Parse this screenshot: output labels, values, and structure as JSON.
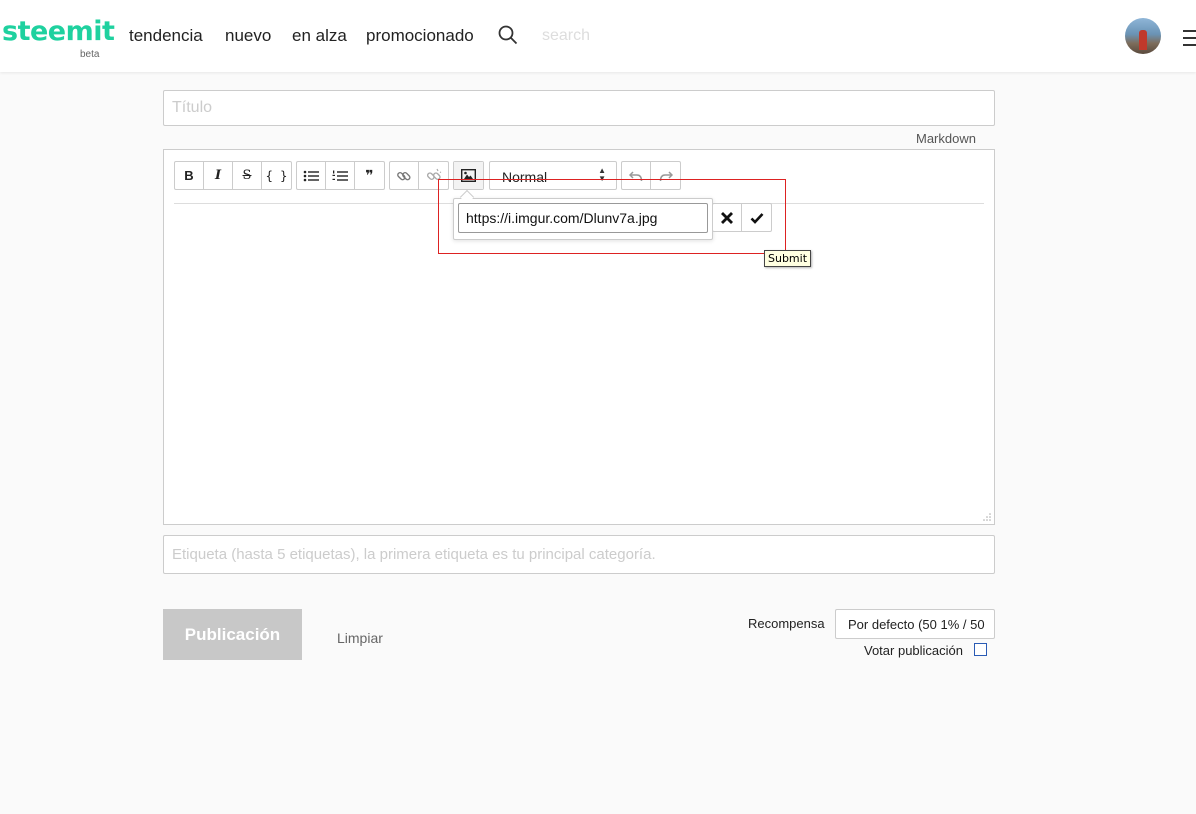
{
  "header": {
    "logo": "steemit",
    "logo_sub": "beta",
    "nav": [
      "tendencia",
      "nuevo",
      "en alza",
      "promocionado"
    ],
    "search_placeholder": "search"
  },
  "editor": {
    "title_placeholder": "Título",
    "markdown_link": "Markdown",
    "toolbar": {
      "bold": "B",
      "italic": "I",
      "strike": "S",
      "code": "{ }",
      "quote": "❞",
      "heading_select": "Normal"
    },
    "image_popup": {
      "url_value": "https://i.imgur.com/Dlunv7a.jpg",
      "tooltip": "Submit"
    }
  },
  "tags_placeholder": "Etiqueta (hasta 5 etiquetas), la primera etiqueta es tu principal categoría.",
  "footer": {
    "publish": "Publicación",
    "clear": "Limpiar",
    "reward_label": "Recompensa",
    "reward_value": "Por defecto (50 1% / 50",
    "vote_label": "Votar publicación"
  },
  "colors": {
    "brand": "#1fd19f",
    "highlight": "#dd2222"
  }
}
